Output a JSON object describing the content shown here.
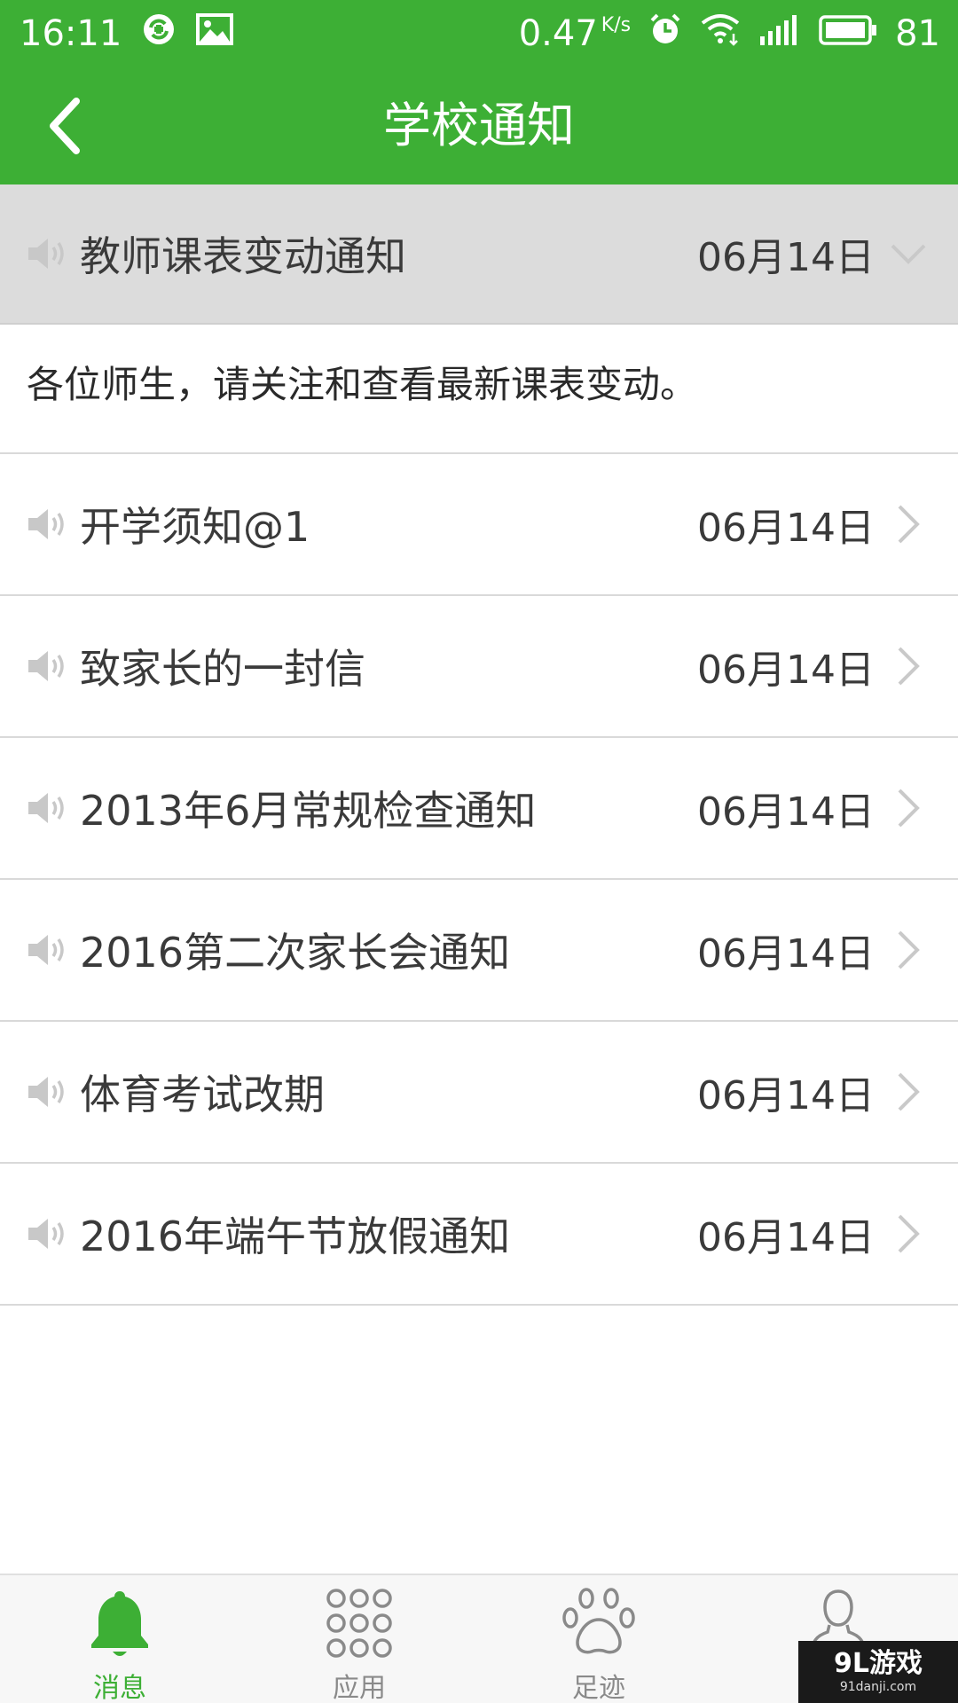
{
  "status_bar": {
    "time": "16:11",
    "speed_value": "0.47",
    "speed_unit": "K/s",
    "battery": "81"
  },
  "header": {
    "title": "学校通知"
  },
  "notices": [
    {
      "title": "教师课表变动通知",
      "date": "06月14日",
      "expanded": true,
      "body": "各位师生，请关注和查看最新课表变动。"
    },
    {
      "title": "开学须知@1",
      "date": "06月14日"
    },
    {
      "title": "致家长的一封信",
      "date": "06月14日"
    },
    {
      "title": "2013年6月常规检查通知",
      "date": "06月14日"
    },
    {
      "title": "2016第二次家长会通知",
      "date": "06月14日"
    },
    {
      "title": "体育考试改期",
      "date": "06月14日"
    },
    {
      "title": "2016年端午节放假通知",
      "date": "06月14日"
    }
  ],
  "bottom_nav": {
    "items": [
      {
        "label": "消息",
        "icon": "bell-icon",
        "active": true
      },
      {
        "label": "应用",
        "icon": "apps-grid-icon",
        "active": false
      },
      {
        "label": "足迹",
        "icon": "paw-icon",
        "active": false
      },
      {
        "label": "",
        "icon": "user-icon",
        "active": false
      }
    ]
  },
  "watermark": {
    "main": "9L游戏",
    "sub": "91danji.com"
  },
  "colors": {
    "brand_green": "#3daf35",
    "expanded_row_bg": "#dcdcdc",
    "nav_inactive": "#8a8a8a"
  }
}
